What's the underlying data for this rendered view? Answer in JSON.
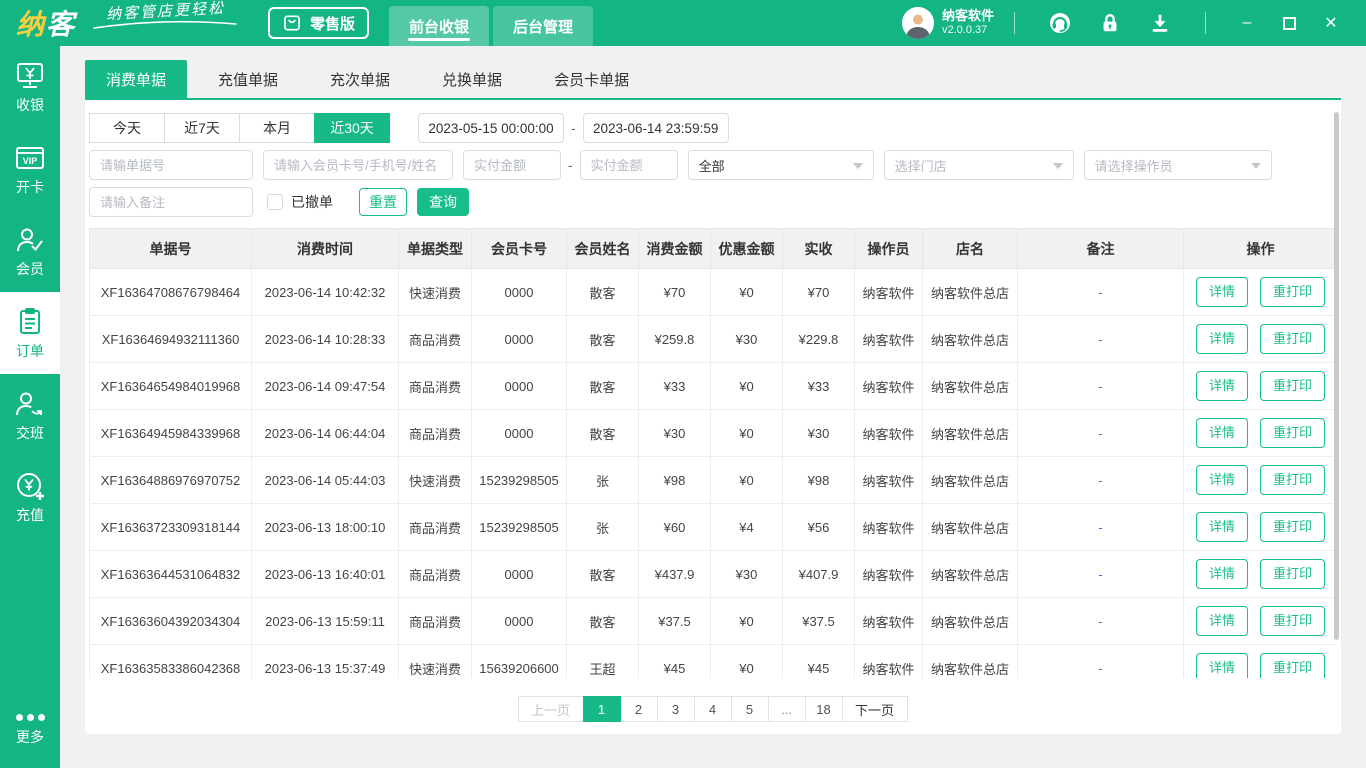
{
  "colors": {
    "primary": "#14b584",
    "accent": "#17bd8b",
    "remark_dash": "#3f74c9",
    "logo_accent": "#f8cf3e"
  },
  "header": {
    "logo_text": "纳客",
    "slogan": "纳客管店更轻松",
    "edition_badge": "零售版",
    "nav_tabs": [
      {
        "label": "前台收银",
        "active": true
      },
      {
        "label": "后台管理",
        "active": false
      }
    ],
    "user": {
      "name": "纳客软件",
      "version": "v2.0.0.37"
    },
    "toolbar_icons": [
      {
        "name": "customer-service-icon"
      },
      {
        "name": "lock-icon"
      },
      {
        "name": "download-icon"
      }
    ],
    "window_controls": {
      "minimize": "–",
      "close": "✕"
    }
  },
  "sidebar": {
    "items": [
      {
        "label": "收银",
        "icon": "cashier",
        "active": false
      },
      {
        "label": "开卡",
        "icon": "vipcard",
        "active": false
      },
      {
        "label": "会员",
        "icon": "member",
        "active": false
      },
      {
        "label": "订单",
        "icon": "order",
        "active": true
      },
      {
        "label": "交班",
        "icon": "shift",
        "active": false
      },
      {
        "label": "充值",
        "icon": "recharge",
        "active": false
      }
    ],
    "more_label": "更多"
  },
  "doc_tabs": [
    {
      "label": "消费单据",
      "active": true
    },
    {
      "label": "充值单据",
      "active": false
    },
    {
      "label": "充次单据",
      "active": false
    },
    {
      "label": "兑换单据",
      "active": false
    },
    {
      "label": "会员卡单据",
      "active": false
    }
  ],
  "filters": {
    "quick_ranges": [
      {
        "label": "今天",
        "active": false
      },
      {
        "label": "近7天",
        "active": false
      },
      {
        "label": "本月",
        "active": false
      },
      {
        "label": "近30天",
        "active": true
      }
    ],
    "date_from": "2023-05-15 00:00:00",
    "date_to": "2023-06-14 23:59:59",
    "range_separator": "-",
    "order_no_placeholder": "请输单据号",
    "member_placeholder": "请输入会员卡号/手机号/姓名",
    "amount_min_placeholder": "实付金额",
    "amount_max_placeholder": "实付金额",
    "amount_separator": "-",
    "selects": [
      {
        "name": "pay-type-select",
        "text": "全部",
        "is_placeholder": false
      },
      {
        "name": "store-select",
        "text": "选择门店",
        "is_placeholder": true
      },
      {
        "name": "operator-select",
        "text": "请选择操作员",
        "is_placeholder": true
      }
    ],
    "remark_placeholder": "请输入备注",
    "voided_checkbox_label": "已撤单",
    "voided_checked": false,
    "reset_label": "重置",
    "search_label": "查询"
  },
  "table": {
    "columns": [
      "单据号",
      "消费时间",
      "单据类型",
      "会员卡号",
      "会员姓名",
      "消费金额",
      "优惠金额",
      "实收",
      "操作员",
      "店名",
      "备注",
      "操作"
    ],
    "action_labels": [
      "详情",
      "重打印"
    ],
    "rows": [
      [
        "XF16364708676798464",
        "2023-06-14 10:42:32",
        "快速消费",
        "0000",
        "散客",
        "¥70",
        "¥0",
        "¥70",
        "纳客软件",
        "纳客软件总店",
        "-"
      ],
      [
        "XF16364694932111360",
        "2023-06-14 10:28:33",
        "商品消费",
        "0000",
        "散客",
        "¥259.8",
        "¥30",
        "¥229.8",
        "纳客软件",
        "纳客软件总店",
        "-"
      ],
      [
        "XF16364654984019968",
        "2023-06-14 09:47:54",
        "商品消费",
        "0000",
        "散客",
        "¥33",
        "¥0",
        "¥33",
        "纳客软件",
        "纳客软件总店",
        "-"
      ],
      [
        "XF16364945984339968",
        "2023-06-14 06:44:04",
        "商品消费",
        "0000",
        "散客",
        "¥30",
        "¥0",
        "¥30",
        "纳客软件",
        "纳客软件总店",
        "-"
      ],
      [
        "XF16364886976970752",
        "2023-06-14 05:44:03",
        "快速消费",
        "15239298505",
        "张",
        "¥98",
        "¥0",
        "¥98",
        "纳客软件",
        "纳客软件总店",
        "-"
      ],
      [
        "XF16363723309318144",
        "2023-06-13 18:00:10",
        "商品消费",
        "15239298505",
        "张",
        "¥60",
        "¥4",
        "¥56",
        "纳客软件",
        "纳客软件总店",
        "-"
      ],
      [
        "XF16363644531064832",
        "2023-06-13 16:40:01",
        "商品消费",
        "0000",
        "散客",
        "¥437.9",
        "¥30",
        "¥407.9",
        "纳客软件",
        "纳客软件总店",
        "-"
      ],
      [
        "XF16363604392034304",
        "2023-06-13 15:59:11",
        "商品消费",
        "0000",
        "散客",
        "¥37.5",
        "¥0",
        "¥37.5",
        "纳客软件",
        "纳客软件总店",
        "-"
      ],
      [
        "XF16363583386042368",
        "2023-06-13 15:37:49",
        "快速消费",
        "15639206600",
        "王超",
        "¥45",
        "¥0",
        "¥45",
        "纳客软件",
        "纳客软件总店",
        "-"
      ]
    ]
  },
  "pagination": {
    "prev_label": "上一页",
    "next_label": "下一页",
    "pages": [
      "1",
      "2",
      "3",
      "4",
      "5",
      "...",
      "18"
    ],
    "active_page": "1"
  }
}
